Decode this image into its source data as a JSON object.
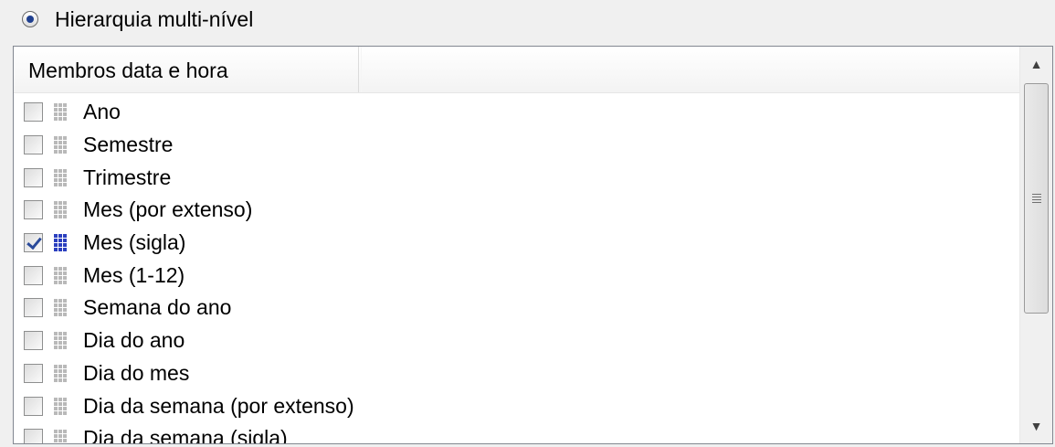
{
  "radio": {
    "label": "Hierarquia multi-nível",
    "selected": true
  },
  "list": {
    "header": "Membros data e hora",
    "items": [
      {
        "label": "Ano",
        "checked": false
      },
      {
        "label": "Semestre",
        "checked": false
      },
      {
        "label": "Trimestre",
        "checked": false
      },
      {
        "label": "Mes (por extenso)",
        "checked": false
      },
      {
        "label": "Mes (sigla)",
        "checked": true
      },
      {
        "label": "Mes (1-12)",
        "checked": false
      },
      {
        "label": "Semana do ano",
        "checked": false
      },
      {
        "label": "Dia do ano",
        "checked": false
      },
      {
        "label": "Dia do mes",
        "checked": false
      },
      {
        "label": "Dia da semana (por extenso)",
        "checked": false
      },
      {
        "label": "Dia da semana (sigla)",
        "checked": false
      }
    ]
  },
  "icons": {
    "scroll_up": "arrow-up-icon",
    "scroll_down": "arrow-down-icon",
    "item_icon": "grid-icon"
  }
}
